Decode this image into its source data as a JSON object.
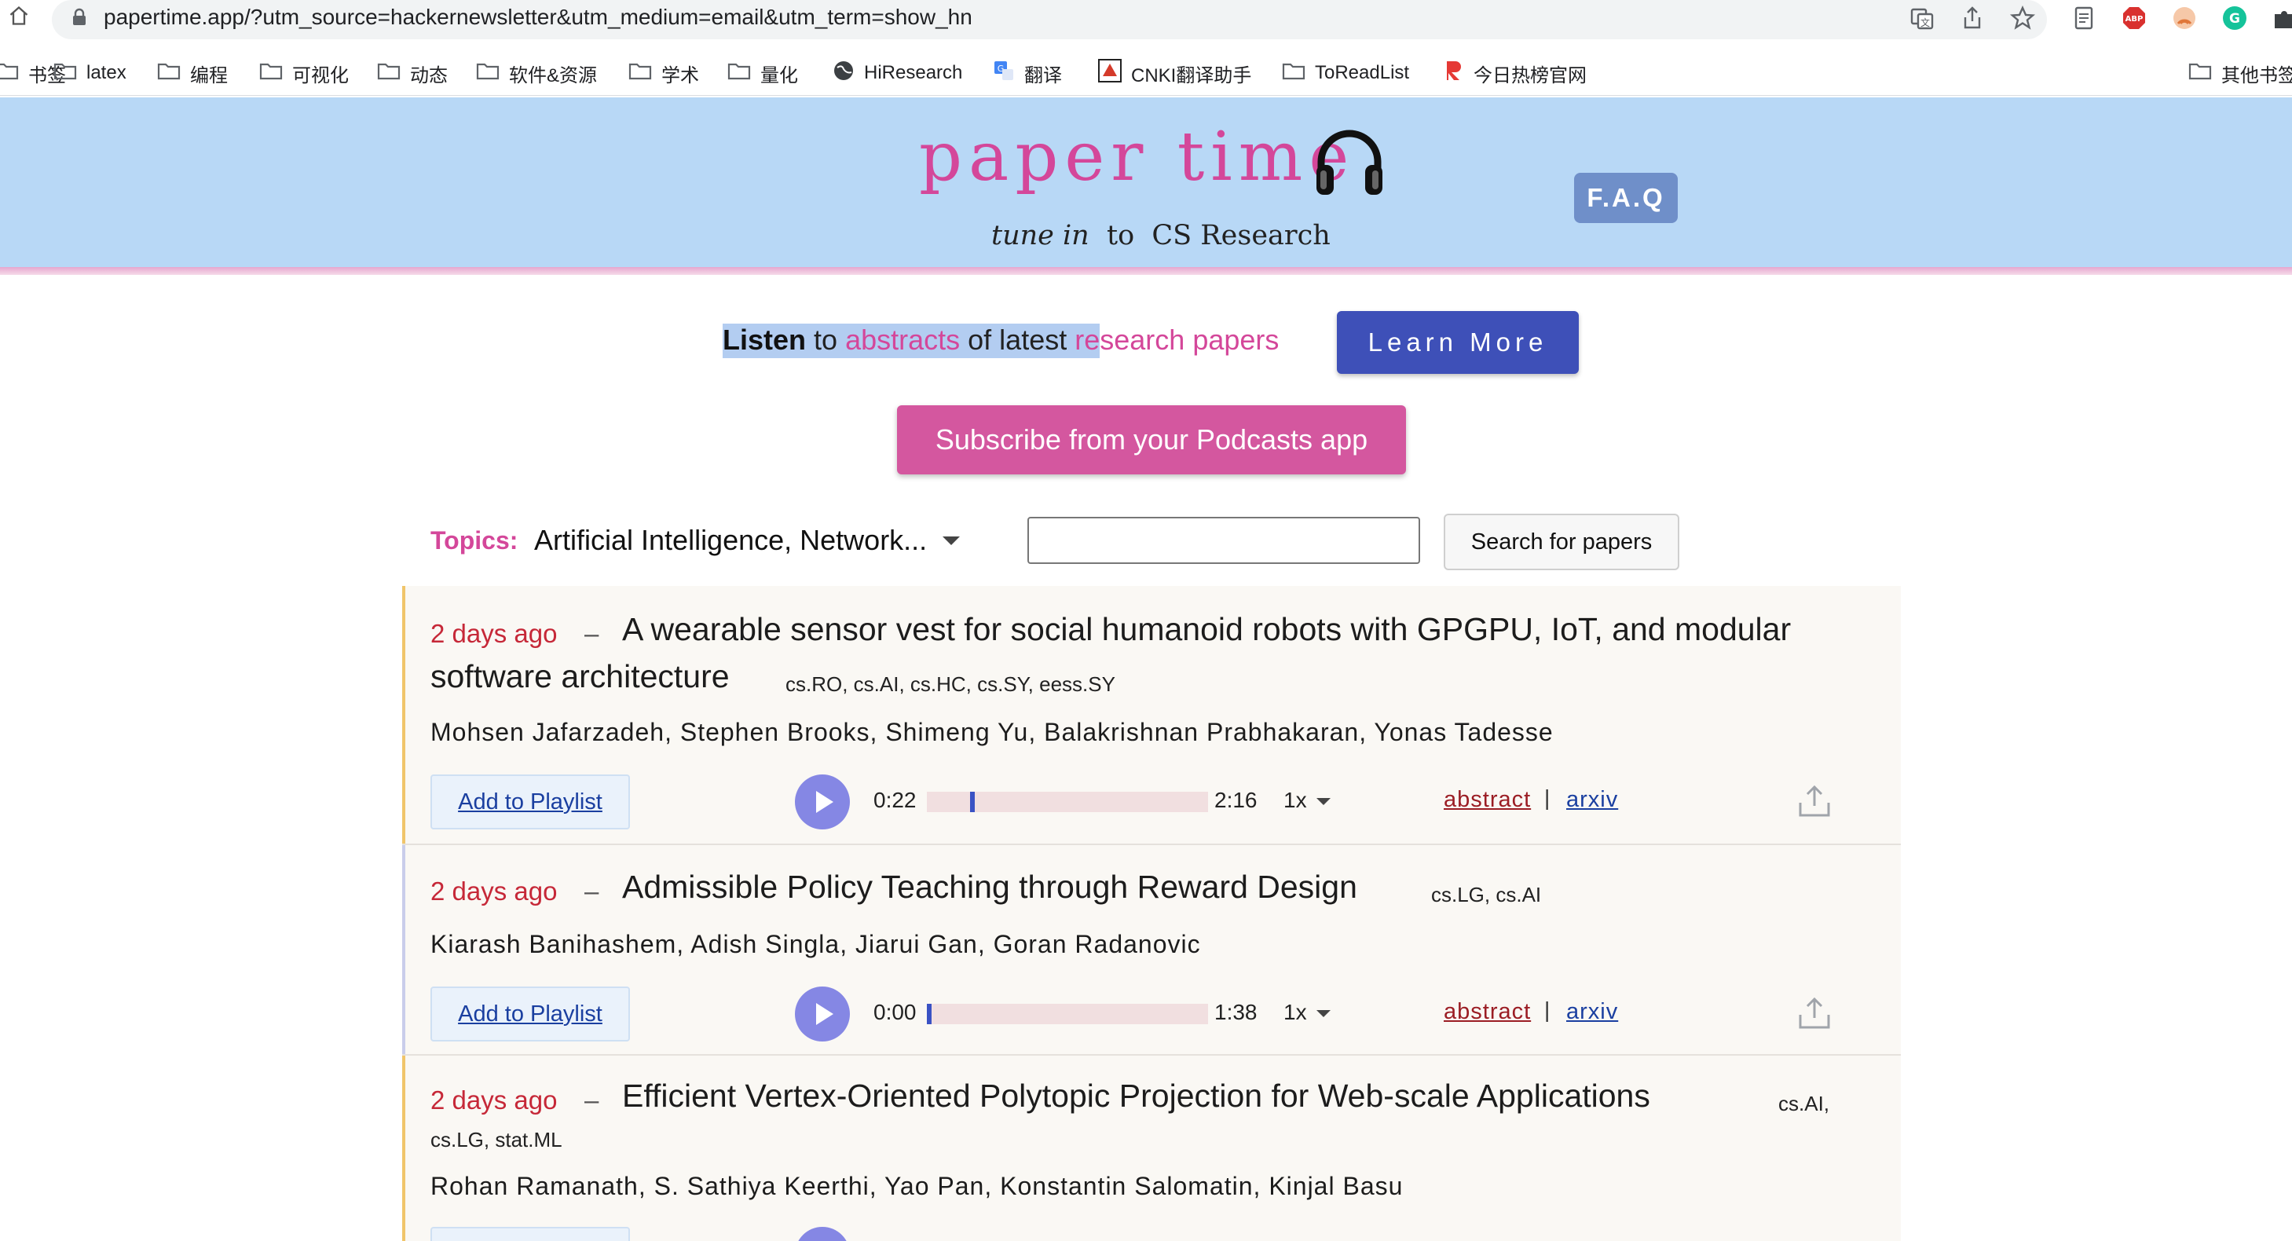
{
  "browser": {
    "url": "papertime.app/?utm_source=hackernewsletter&utm_medium=email&utm_term=show_hn",
    "bookmarks": [
      {
        "label": "书签",
        "icon": "folder-icon"
      },
      {
        "label": "latex",
        "icon": "folder-icon"
      },
      {
        "label": "编程",
        "icon": "folder-icon"
      },
      {
        "label": "可视化",
        "icon": "folder-icon"
      },
      {
        "label": "动态",
        "icon": "folder-icon"
      },
      {
        "label": "软件&资源",
        "icon": "folder-icon"
      },
      {
        "label": "学术",
        "icon": "folder-icon"
      },
      {
        "label": "量化",
        "icon": "folder-icon"
      },
      {
        "label": "HiResearch",
        "icon": "globe-icon"
      },
      {
        "label": "翻译",
        "icon": "translate-icon"
      },
      {
        "label": "CNKI翻译助手",
        "icon": "cnki-icon"
      },
      {
        "label": "ToReadList",
        "icon": "folder-icon"
      },
      {
        "label": "今日热榜官网",
        "icon": "r-logo-icon"
      },
      {
        "label": "其他书签",
        "icon": "folder-icon"
      }
    ],
    "extension_badges": {
      "abp": "ABP",
      "grammarly": "G"
    }
  },
  "header": {
    "logo": "paper time",
    "tagline": {
      "tune_in": "tune in",
      "to": "to",
      "subject": "CS Research"
    },
    "faq_label": "F.A.Q"
  },
  "hero": {
    "listen": "Listen",
    "to": "to",
    "abstracts": "abstracts",
    "of_latest": "of latest",
    "research_papers": "research papers",
    "learn_more": "Learn More",
    "subscribe": "Subscribe from your Podcasts app"
  },
  "filters": {
    "topics_label": "Topics:",
    "topics_value": "Artificial Intelligence, Network...",
    "search_value": "",
    "search_button": "Search for papers"
  },
  "papers": [
    {
      "age": "2 days ago",
      "dash": "–",
      "title_line1": "A wearable sensor vest for social humanoid robots with GPGPU, IoT, and modular",
      "title_line2": "software architecture",
      "categories": "cs.RO, cs.AI, cs.HC, cs.SY, eess.SY",
      "authors": "Mohsen Jafarzadeh, Stephen Brooks, Shimeng Yu, Balakrishnan Prabhakaran, Yonas Tadesse",
      "add_to_playlist": "Add to Playlist",
      "current_time": "0:22",
      "duration": "2:16",
      "progress": 0.162,
      "speed": "1x",
      "abstract_link": "abstract",
      "separator": "|",
      "arxiv_link": "arxiv",
      "accent_color": "#f0c56a"
    },
    {
      "age": "2 days ago",
      "dash": "–",
      "title_line1": "Admissible Policy Teaching through Reward Design",
      "title_line2": "",
      "categories": "cs.LG, cs.AI",
      "authors": "Kiarash Banihashem, Adish Singla, Jiarui Gan, Goran Radanovic",
      "add_to_playlist": "Add to Playlist",
      "current_time": "0:00",
      "duration": "1:38",
      "progress": 0,
      "speed": "1x",
      "abstract_link": "abstract",
      "separator": "|",
      "arxiv_link": "arxiv",
      "accent_color": "#c9cdea"
    },
    {
      "age": "2 days ago",
      "dash": "–",
      "title_line1": "Efficient Vertex-Oriented Polytopic Projection for Web-scale Applications",
      "title_line2": "",
      "categories_line1": "cs.AI,",
      "categories_line2": "cs.LG, stat.ML",
      "authors": "Rohan Ramanath, S. Sathiya Keerthi, Yao Pan, Konstantin Salomatin, Kinjal Basu",
      "accent_color": "#f0c56a"
    }
  ],
  "colors": {
    "header_bg": "#b8d8f6",
    "brand_pink": "#d4479a",
    "learn_more_bg": "#3e50b8",
    "subscribe_bg": "#d4579f",
    "faq_bg": "#6f8fc9",
    "age_red": "#c62838",
    "play_button": "#8587e4"
  }
}
